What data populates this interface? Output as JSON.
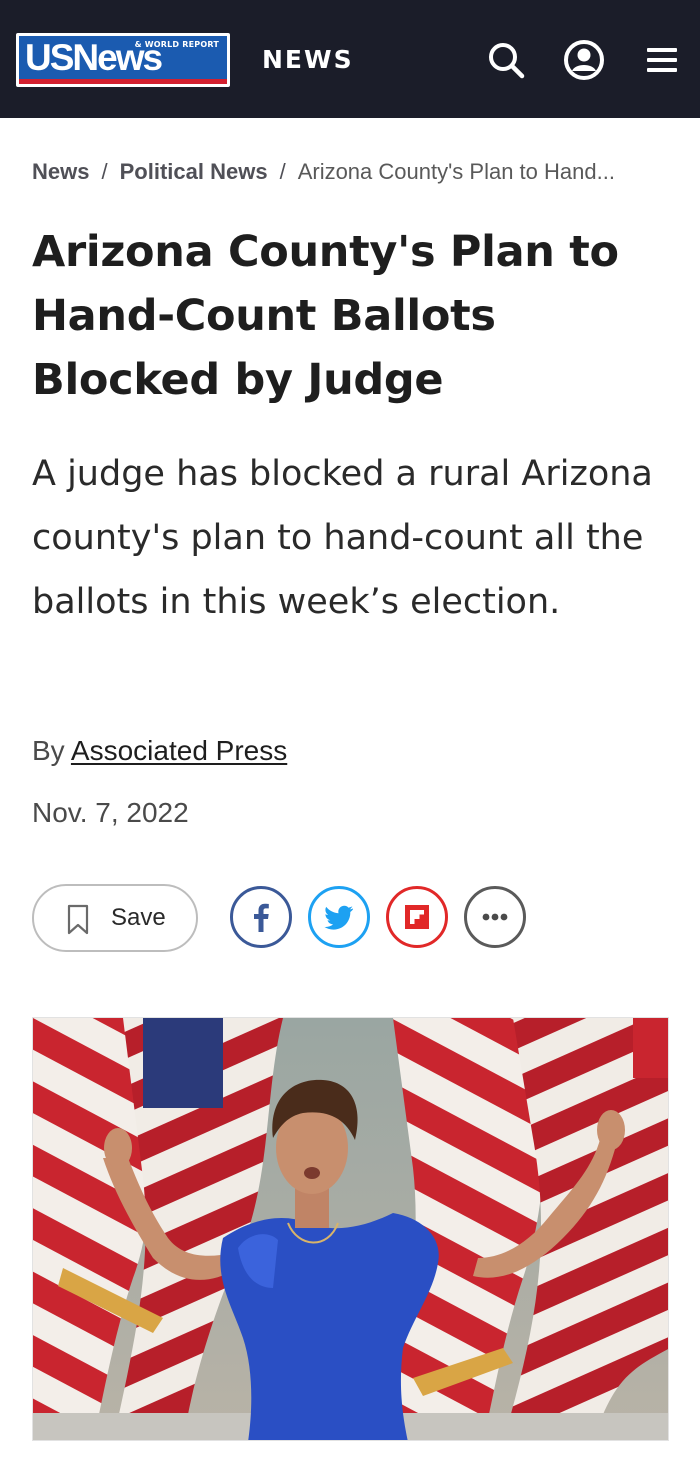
{
  "header": {
    "logo_main": "USNews",
    "logo_sub": "& WORLD REPORT",
    "section": "NEWS",
    "icons": [
      "search-icon",
      "account-icon",
      "menu-icon"
    ]
  },
  "breadcrumb": {
    "items": [
      "News",
      "Political News"
    ],
    "separator": "/",
    "current": "Arizona County's Plan to Hand..."
  },
  "article": {
    "headline": "Arizona County's Plan to Hand-Count Ballots Blocked by Judge",
    "dek": "A judge has blocked a rural Arizona county's plan to hand-count all the ballots in this week’s election.",
    "by_prefix": "By",
    "author": "Associated Press",
    "date": "Nov. 7, 2022"
  },
  "actions": {
    "save_label": "Save",
    "share_icons": [
      "facebook-icon",
      "twitter-icon",
      "flipboard-icon",
      "more-icon"
    ]
  },
  "colors": {
    "header_bg": "#1b1d29",
    "logo_blue": "#1b5bb0",
    "logo_red": "#d3202f",
    "facebook": "#3b5998",
    "twitter": "#1da1f2",
    "flipboard": "#e12828"
  }
}
